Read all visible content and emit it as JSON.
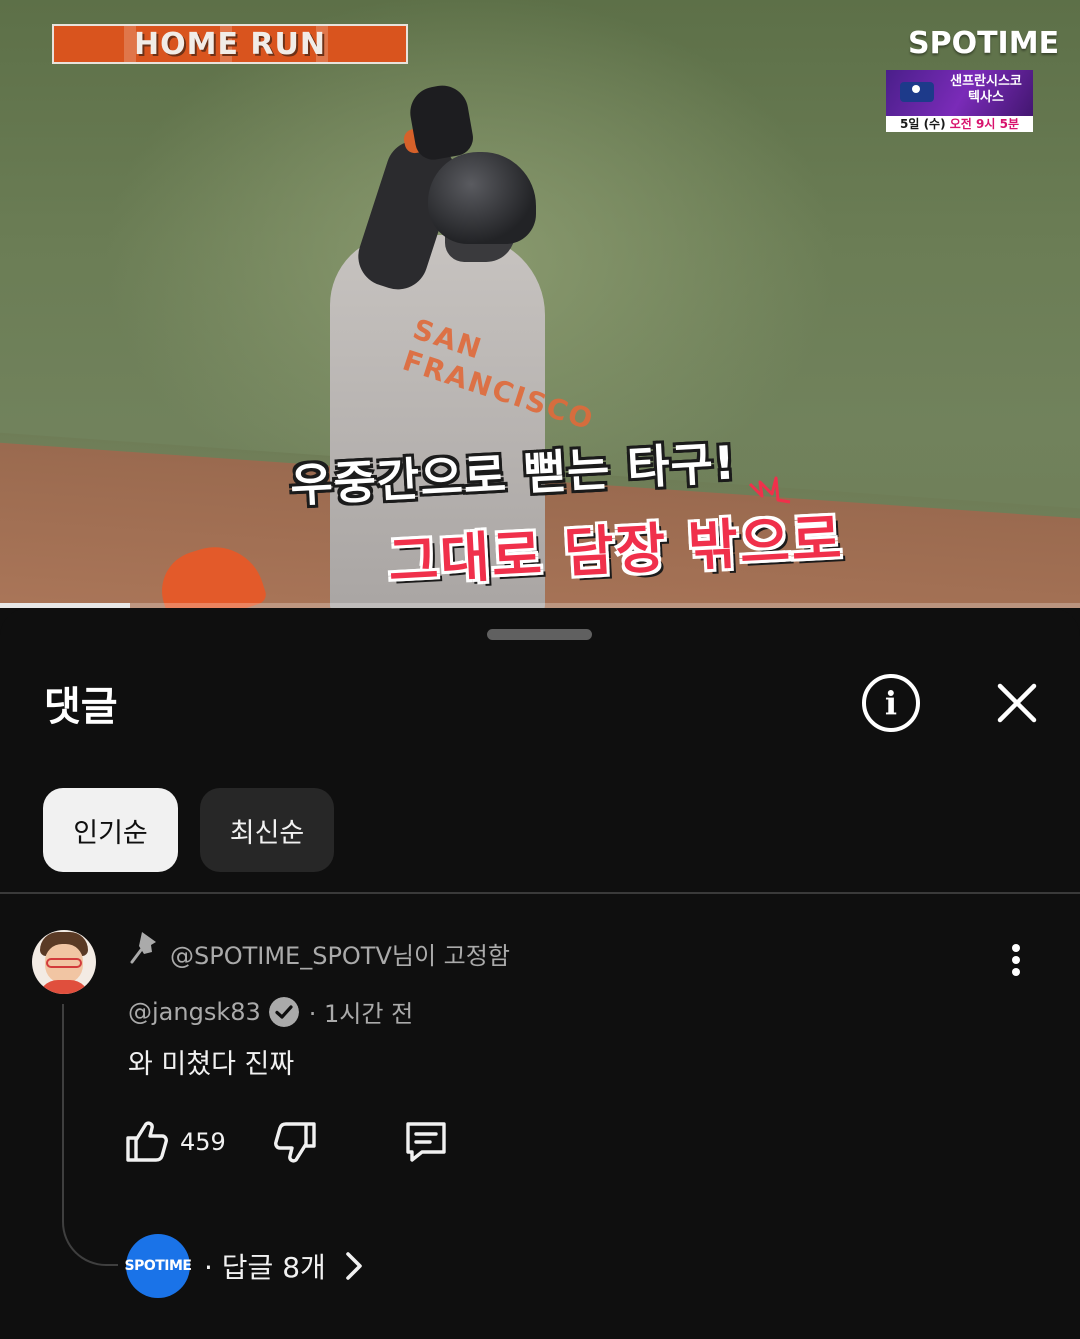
{
  "video": {
    "banner_text": "HOME RUN",
    "jersey_text": "SAN FRANCISCO",
    "brand": "SPOTIME",
    "promo": {
      "teams_line1": "샌프란시스코",
      "teams_line2": "텍사스",
      "date_prefix": "5일 (수) ",
      "date_time": "오전 9시 5분"
    },
    "caption_line1": "우중간으로 뻗는 타구!",
    "caption_line2": "그대로 담장 밖으로",
    "progress": 0.12
  },
  "comments_panel": {
    "title": "댓글",
    "sort_chips": [
      {
        "label": "인기순",
        "active": true
      },
      {
        "label": "최신순",
        "active": false
      }
    ],
    "pinned_comment": {
      "pinned_by": "@SPOTIME_SPOTV님이 고정함",
      "author": "@jangsk83",
      "timestamp": "· 1시간 전",
      "text": "와 미쳤다 진짜",
      "like_count": "459",
      "reply_avatar_label": "SPOTIME",
      "replies_text": "· 답글 8개"
    }
  },
  "colors": {
    "background": "#0f0f0f",
    "chip_active": "#f1f1f1",
    "chip_inactive": "#272727",
    "secondary_text": "#aaaaaa",
    "reply_avatar": "#1a73e8",
    "caption_red": "#f0304b",
    "banner_orange": "#d9541e"
  },
  "icons": [
    "pin-icon",
    "info-icon",
    "close-icon",
    "more-vert-icon",
    "verified-icon",
    "thumb-up-icon",
    "thumb-down-icon",
    "reply-icon",
    "chevron-right-icon"
  ]
}
